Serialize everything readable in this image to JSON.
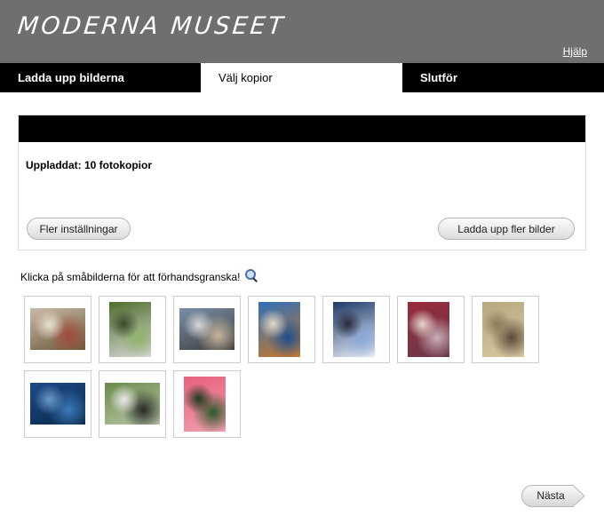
{
  "header": {
    "logo_text": "MODERNA MUSEET",
    "help_label": "Hjälp"
  },
  "tabs": [
    {
      "label": "Ladda upp bilderna",
      "active": false
    },
    {
      "label": "Välj kopior",
      "active": true
    },
    {
      "label": "Slutför",
      "active": false
    }
  ],
  "panel": {
    "uploaded_text": "Uppladdat: 10 fotokopior",
    "settings_button": "Fler inställningar",
    "upload_more_button": "Ladda upp fler bilder"
  },
  "gallery": {
    "instruction": "Klicka på småbilderna för att förhandsgranska!",
    "thumbnails": [
      {
        "subject": "cake-table",
        "orientation": "landscape",
        "colors": [
          "#c9b9a8",
          "#a14b3c",
          "#6b5b3a",
          "#e8e0d0"
        ]
      },
      {
        "subject": "garden-fence",
        "orientation": "portrait",
        "colors": [
          "#4d6e2c",
          "#8fb26a",
          "#d8d8d8",
          "#3a4a2a"
        ]
      },
      {
        "subject": "people-group",
        "orientation": "landscape",
        "colors": [
          "#7a8fa8",
          "#c8b49a",
          "#3d3d3d",
          "#d9d9d9"
        ]
      },
      {
        "subject": "picnic-blanket",
        "orientation": "portrait",
        "colors": [
          "#2f6fb8",
          "#1f4f8f",
          "#c77a2c",
          "#e0d8c8"
        ]
      },
      {
        "subject": "sky-contrail",
        "orientation": "portrait",
        "colors": [
          "#1e3a6a",
          "#8aa8d8",
          "#e8eef8",
          "#2a2a3a"
        ]
      },
      {
        "subject": "berries-bowl",
        "orientation": "portrait",
        "colors": [
          "#9a2a3a",
          "#c8b0b8",
          "#6a3a4a",
          "#e8d8d0"
        ]
      },
      {
        "subject": "couple-sunny",
        "orientation": "portrait",
        "colors": [
          "#b8a880",
          "#5a4a3a",
          "#d8c8a0",
          "#8a7a5a"
        ]
      },
      {
        "subject": "blue-boat",
        "orientation": "landscape",
        "colors": [
          "#1e4a8a",
          "#3a7ab8",
          "#0a2a4a",
          "#6a9ac8"
        ]
      },
      {
        "subject": "cows-field",
        "orientation": "landscape",
        "colors": [
          "#6a8a4a",
          "#2a2a2a",
          "#b8c8a8",
          "#e8e8e8"
        ]
      },
      {
        "subject": "pink-flower",
        "orientation": "portrait",
        "colors": [
          "#e8607a",
          "#2a5a2a",
          "#f0a0b0",
          "#1a3a1a"
        ]
      }
    ]
  },
  "footer": {
    "next_label": "Nästa"
  },
  "colors": {
    "header_bg": "#6f6f6f",
    "tab_bar": "#000000",
    "active_tab": "#ffffff"
  }
}
